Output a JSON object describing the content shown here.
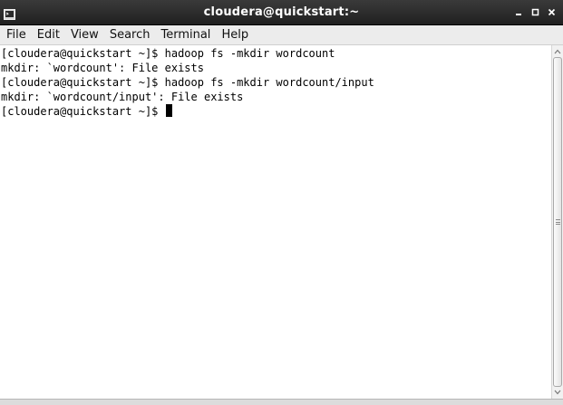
{
  "window": {
    "title": "cloudera@quickstart:~"
  },
  "menubar": {
    "items": [
      "File",
      "Edit",
      "View",
      "Search",
      "Terminal",
      "Help"
    ]
  },
  "terminal": {
    "lines": [
      "[cloudera@quickstart ~]$ hadoop fs -mkdir wordcount",
      "mkdir: `wordcount': File exists",
      "[cloudera@quickstart ~]$ hadoop fs -mkdir wordcount/input",
      "mkdir: `wordcount/input': File exists",
      "[cloudera@quickstart ~]$ "
    ]
  },
  "colors": {
    "titlebar": "#2c2c2c",
    "terminal_bg": "#ffffff",
    "terminal_fg": "#000000"
  },
  "icons": {
    "app": "terminal-icon",
    "minimize": "minimize-icon",
    "maximize": "maximize-icon",
    "close": "close-icon"
  }
}
